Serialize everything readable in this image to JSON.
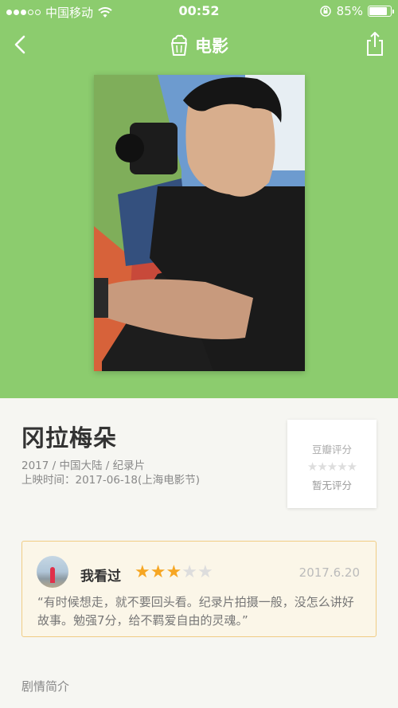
{
  "status_bar": {
    "carrier": "中国移动",
    "time": "00:52",
    "battery_percent": "85%",
    "battery_level": 0.85
  },
  "navbar": {
    "title": "电影",
    "icons": {
      "back": "chevron-left-icon",
      "category": "popcorn-icon",
      "share": "share-icon"
    }
  },
  "movie": {
    "title": "冈拉梅朵",
    "meta": "2017 / 中国大陆 / 纪录片",
    "release": "上映时间：2017-06-18(上海电影节)"
  },
  "rating": {
    "label": "豆瓣评分",
    "stars": "★★★★★",
    "empty_text": "暂无评分"
  },
  "review": {
    "status_label": "我看过",
    "stars_filled": 3,
    "stars_total": 5,
    "date": "2017.6.20",
    "text": "“有时候想走，就不要回头看。纪录片拍摄一般，没怎么讲好故事。勉强7分，给不羁爱自由的灵魂。”"
  },
  "synopsis": {
    "label": "剧情简介"
  },
  "colors": {
    "header_green": "#8ccc6e",
    "page_bg": "#f6f6f2",
    "star_orange": "#f6a623",
    "card_border": "#f0cc84",
    "card_bg": "#fbf6e8"
  }
}
